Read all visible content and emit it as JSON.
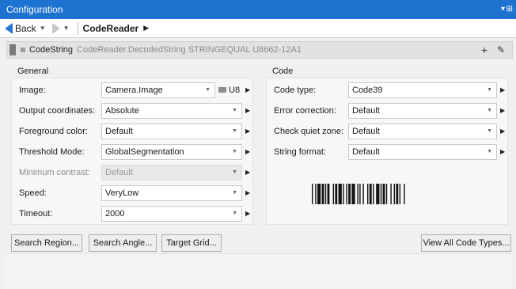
{
  "window": {
    "title": "Configuration"
  },
  "nav": {
    "back_label": "Back",
    "breadcrumb": "CodeReader"
  },
  "tool": {
    "name": "CodeString",
    "expression": "CodeReader.DecodedString  STRINGEQUAL  U8662-12A1"
  },
  "general": {
    "title": "General",
    "image": {
      "label": "Image:",
      "value": "Camera.Image",
      "type": "U8"
    },
    "output_coordinates": {
      "label": "Output coordinates:",
      "value": "Absolute"
    },
    "foreground_color": {
      "label": "Foreground color:",
      "value": "Default"
    },
    "threshold_mode": {
      "label": "Threshold Mode:",
      "value": "GlobalSegmentation"
    },
    "minimum_contrast": {
      "label": "Minimum contrast:",
      "value": "Default"
    },
    "speed": {
      "label": "Speed:",
      "value": "VeryLow"
    },
    "timeout": {
      "label": "Timeout:",
      "value": "2000"
    }
  },
  "code": {
    "title": "Code",
    "code_type": {
      "label": "Code type:",
      "value": "Code39"
    },
    "error_correction": {
      "label": "Error correction:",
      "value": "Default"
    },
    "check_quiet_zone": {
      "label": "Check quiet zone:",
      "value": "Default"
    },
    "string_format": {
      "label": "String format:",
      "value": "Default"
    }
  },
  "buttons": {
    "search_region": "Search Region...",
    "search_angle": "Search Angle...",
    "target_grid": "Target Grid...",
    "view_all_code_types": "View All Code Types..."
  }
}
